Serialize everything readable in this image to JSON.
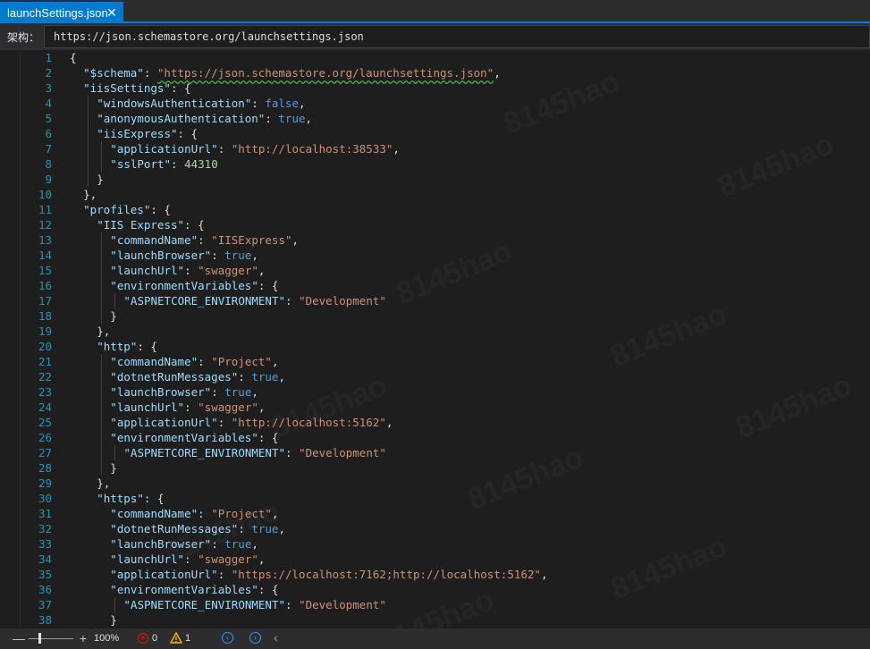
{
  "tab": {
    "title": "launchSettings.json",
    "close_glyph": "✕"
  },
  "schema_bar": {
    "label": "架构：",
    "value": "https://json.schemastore.org/launchsettings.json"
  },
  "watermark": "8145hao",
  "colors": {
    "accent": "#007acc",
    "background": "#1e1e1e",
    "line_number": "#2b91af",
    "json_key": "#9cdcfe",
    "json_string": "#ce9178",
    "json_boolean": "#569cd6",
    "json_number": "#b5cea8"
  },
  "editor": {
    "lines": [
      {
        "n": "1",
        "indent": 0,
        "tokens": [
          {
            "t": "{",
            "c": "p"
          }
        ]
      },
      {
        "n": "2",
        "indent": 1,
        "tokens": [
          {
            "t": "\"$schema\"",
            "c": "k"
          },
          {
            "t": ": ",
            "c": "p"
          },
          {
            "t": "\"https://json.schemastore.org/launchsettings.json\"",
            "c": "u"
          },
          {
            "t": ",",
            "c": "p"
          }
        ]
      },
      {
        "n": "3",
        "indent": 1,
        "tokens": [
          {
            "t": "\"iisSettings\"",
            "c": "k"
          },
          {
            "t": ": {",
            "c": "p"
          }
        ]
      },
      {
        "n": "4",
        "indent": 2,
        "tokens": [
          {
            "t": "\"windowsAuthentication\"",
            "c": "k"
          },
          {
            "t": ": ",
            "c": "p"
          },
          {
            "t": "false",
            "c": "b"
          },
          {
            "t": ",",
            "c": "p"
          }
        ]
      },
      {
        "n": "5",
        "indent": 2,
        "tokens": [
          {
            "t": "\"anonymousAuthentication\"",
            "c": "k"
          },
          {
            "t": ": ",
            "c": "p"
          },
          {
            "t": "true",
            "c": "b"
          },
          {
            "t": ",",
            "c": "p"
          }
        ]
      },
      {
        "n": "6",
        "indent": 2,
        "tokens": [
          {
            "t": "\"iisExpress\"",
            "c": "k"
          },
          {
            "t": ": {",
            "c": "p"
          }
        ]
      },
      {
        "n": "7",
        "indent": 3,
        "tokens": [
          {
            "t": "\"applicationUrl\"",
            "c": "k"
          },
          {
            "t": ": ",
            "c": "p"
          },
          {
            "t": "\"http://localhost:38533\"",
            "c": "s"
          },
          {
            "t": ",",
            "c": "p"
          }
        ]
      },
      {
        "n": "8",
        "indent": 3,
        "tokens": [
          {
            "t": "\"sslPort\"",
            "c": "k"
          },
          {
            "t": ": ",
            "c": "p"
          },
          {
            "t": "44310",
            "c": "n"
          }
        ]
      },
      {
        "n": "9",
        "indent": 2,
        "tokens": [
          {
            "t": "}",
            "c": "p"
          }
        ]
      },
      {
        "n": "10",
        "indent": 1,
        "tokens": [
          {
            "t": "},",
            "c": "p"
          }
        ]
      },
      {
        "n": "11",
        "indent": 1,
        "tokens": [
          {
            "t": "\"profiles\"",
            "c": "k"
          },
          {
            "t": ": {",
            "c": "p"
          }
        ]
      },
      {
        "n": "12",
        "indent": 2,
        "tokens": [
          {
            "t": "\"IIS Express\"",
            "c": "k"
          },
          {
            "t": ": {",
            "c": "p"
          }
        ]
      },
      {
        "n": "13",
        "indent": 3,
        "tokens": [
          {
            "t": "\"commandName\"",
            "c": "k"
          },
          {
            "t": ": ",
            "c": "p"
          },
          {
            "t": "\"IISExpress\"",
            "c": "s"
          },
          {
            "t": ",",
            "c": "p"
          }
        ]
      },
      {
        "n": "14",
        "indent": 3,
        "tokens": [
          {
            "t": "\"launchBrowser\"",
            "c": "k"
          },
          {
            "t": ": ",
            "c": "p"
          },
          {
            "t": "true",
            "c": "b"
          },
          {
            "t": ",",
            "c": "p"
          }
        ]
      },
      {
        "n": "15",
        "indent": 3,
        "tokens": [
          {
            "t": "\"launchUrl\"",
            "c": "k"
          },
          {
            "t": ": ",
            "c": "p"
          },
          {
            "t": "\"swagger\"",
            "c": "s"
          },
          {
            "t": ",",
            "c": "p"
          }
        ]
      },
      {
        "n": "16",
        "indent": 3,
        "tokens": [
          {
            "t": "\"environmentVariables\"",
            "c": "k"
          },
          {
            "t": ": {",
            "c": "p"
          }
        ]
      },
      {
        "n": "17",
        "indent": 4,
        "tokens": [
          {
            "t": "\"ASPNETCORE_ENVIRONMENT\"",
            "c": "k"
          },
          {
            "t": ": ",
            "c": "p"
          },
          {
            "t": "\"Development\"",
            "c": "s"
          }
        ]
      },
      {
        "n": "18",
        "indent": 3,
        "tokens": [
          {
            "t": "}",
            "c": "p"
          }
        ]
      },
      {
        "n": "19",
        "indent": 2,
        "tokens": [
          {
            "t": "},",
            "c": "p"
          }
        ]
      },
      {
        "n": "20",
        "indent": 2,
        "tokens": [
          {
            "t": "\"http\"",
            "c": "k"
          },
          {
            "t": ": {",
            "c": "p"
          }
        ]
      },
      {
        "n": "21",
        "indent": 3,
        "tokens": [
          {
            "t": "\"commandName\"",
            "c": "k"
          },
          {
            "t": ": ",
            "c": "p"
          },
          {
            "t": "\"Project\"",
            "c": "s"
          },
          {
            "t": ",",
            "c": "p"
          }
        ]
      },
      {
        "n": "22",
        "indent": 3,
        "tokens": [
          {
            "t": "\"dotnetRunMessages\"",
            "c": "k"
          },
          {
            "t": ": ",
            "c": "p"
          },
          {
            "t": "true",
            "c": "b"
          },
          {
            "t": ",",
            "c": "p"
          }
        ]
      },
      {
        "n": "23",
        "indent": 3,
        "tokens": [
          {
            "t": "\"launchBrowser\"",
            "c": "k"
          },
          {
            "t": ": ",
            "c": "p"
          },
          {
            "t": "true",
            "c": "b"
          },
          {
            "t": ",",
            "c": "p"
          }
        ]
      },
      {
        "n": "24",
        "indent": 3,
        "tokens": [
          {
            "t": "\"launchUrl\"",
            "c": "k"
          },
          {
            "t": ": ",
            "c": "p"
          },
          {
            "t": "\"swagger\"",
            "c": "s"
          },
          {
            "t": ",",
            "c": "p"
          }
        ]
      },
      {
        "n": "25",
        "indent": 3,
        "tokens": [
          {
            "t": "\"applicationUrl\"",
            "c": "k"
          },
          {
            "t": ": ",
            "c": "p"
          },
          {
            "t": "\"http://localhost:5162\"",
            "c": "s"
          },
          {
            "t": ",",
            "c": "p"
          }
        ]
      },
      {
        "n": "26",
        "indent": 3,
        "tokens": [
          {
            "t": "\"environmentVariables\"",
            "c": "k"
          },
          {
            "t": ": {",
            "c": "p"
          }
        ]
      },
      {
        "n": "27",
        "indent": 4,
        "tokens": [
          {
            "t": "\"ASPNETCORE_ENVIRONMENT\"",
            "c": "k"
          },
          {
            "t": ": ",
            "c": "p"
          },
          {
            "t": "\"Development\"",
            "c": "s"
          }
        ]
      },
      {
        "n": "28",
        "indent": 3,
        "tokens": [
          {
            "t": "}",
            "c": "p"
          }
        ]
      },
      {
        "n": "29",
        "indent": 2,
        "tokens": [
          {
            "t": "},",
            "c": "p"
          }
        ]
      },
      {
        "n": "30",
        "indent": 2,
        "tokens": [
          {
            "t": "\"https\"",
            "c": "k"
          },
          {
            "t": ": {",
            "c": "p"
          }
        ]
      },
      {
        "n": "31",
        "indent": 3,
        "tokens": [
          {
            "t": "\"commandName\"",
            "c": "k"
          },
          {
            "t": ": ",
            "c": "p"
          },
          {
            "t": "\"Project\"",
            "c": "s"
          },
          {
            "t": ",",
            "c": "p"
          }
        ]
      },
      {
        "n": "32",
        "indent": 3,
        "tokens": [
          {
            "t": "\"dotnetRunMessages\"",
            "c": "k"
          },
          {
            "t": ": ",
            "c": "p"
          },
          {
            "t": "true",
            "c": "b"
          },
          {
            "t": ",",
            "c": "p"
          }
        ]
      },
      {
        "n": "33",
        "indent": 3,
        "tokens": [
          {
            "t": "\"launchBrowser\"",
            "c": "k"
          },
          {
            "t": ": ",
            "c": "p"
          },
          {
            "t": "true",
            "c": "b"
          },
          {
            "t": ",",
            "c": "p"
          }
        ]
      },
      {
        "n": "34",
        "indent": 3,
        "tokens": [
          {
            "t": "\"launchUrl\"",
            "c": "k"
          },
          {
            "t": ": ",
            "c": "p"
          },
          {
            "t": "\"swagger\"",
            "c": "s"
          },
          {
            "t": ",",
            "c": "p"
          }
        ]
      },
      {
        "n": "35",
        "indent": 3,
        "tokens": [
          {
            "t": "\"applicationUrl\"",
            "c": "k"
          },
          {
            "t": ": ",
            "c": "p"
          },
          {
            "t": "\"https://localhost:7162;http://localhost:5162\"",
            "c": "s"
          },
          {
            "t": ",",
            "c": "p"
          }
        ]
      },
      {
        "n": "36",
        "indent": 3,
        "tokens": [
          {
            "t": "\"environmentVariables\"",
            "c": "k"
          },
          {
            "t": ": {",
            "c": "p"
          }
        ]
      },
      {
        "n": "37",
        "indent": 4,
        "tokens": [
          {
            "t": "\"ASPNETCORE_ENVIRONMENT\"",
            "c": "k"
          },
          {
            "t": ": ",
            "c": "p"
          },
          {
            "t": "\"Development\"",
            "c": "s"
          }
        ]
      },
      {
        "n": "38",
        "indent": 3,
        "tokens": [
          {
            "t": "}",
            "c": "p"
          }
        ]
      }
    ]
  },
  "status_bar": {
    "zoom_minus": "—",
    "zoom_plus": "+",
    "zoom_level": "100%",
    "errors": "0",
    "warnings": "1",
    "back_glyph": "‹",
    "prev_glyph": "‹",
    "next_glyph": "›"
  }
}
